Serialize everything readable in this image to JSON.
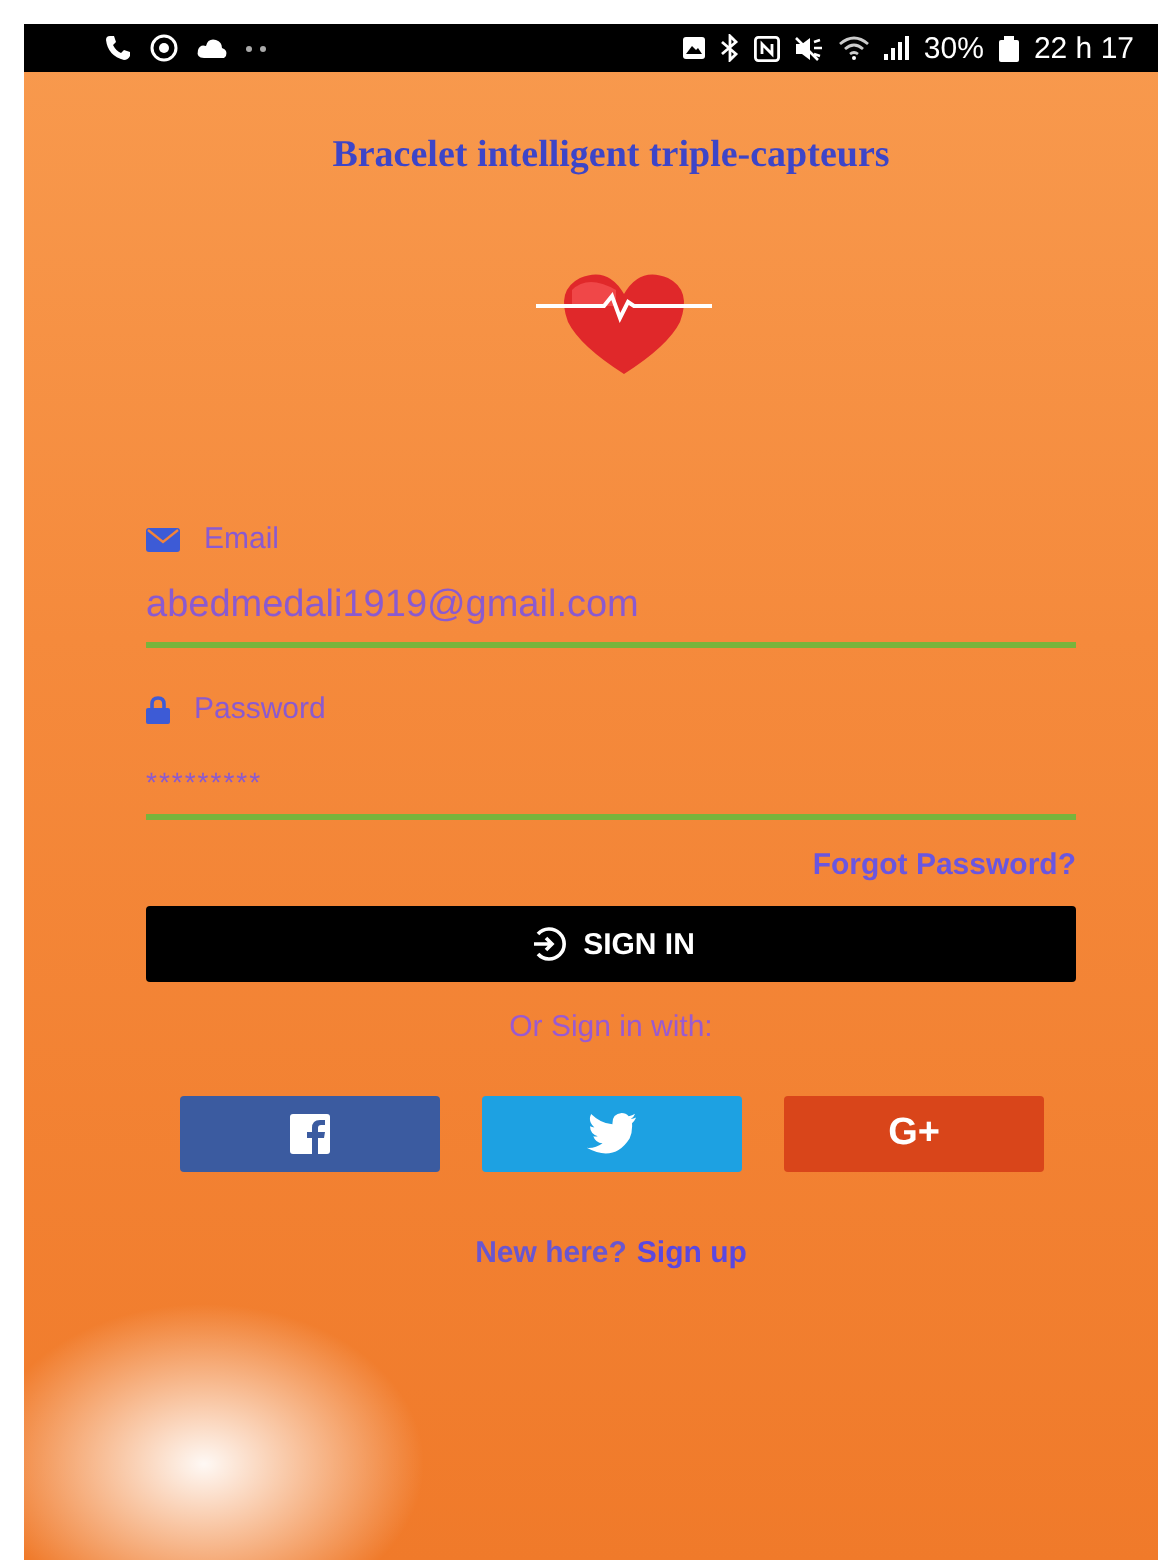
{
  "status_bar": {
    "battery": "30%",
    "time": "22 h 17"
  },
  "title": "Bracelet intelligent triple-capteurs",
  "form": {
    "email": {
      "label": "Email",
      "value": "abedmedali1919@gmail.com"
    },
    "password": {
      "label": "Password",
      "value": "*********"
    },
    "forgot_link": "Forgot Password?",
    "sign_in_button": "SIGN IN",
    "alt_prompt": "Or Sign in with:",
    "social_buttons": [
      {
        "kind": "facebook"
      },
      {
        "kind": "twitter"
      },
      {
        "kind": "google",
        "label": "G+"
      }
    ],
    "signup": {
      "prompt": "New here?",
      "link": "Sign up"
    }
  }
}
